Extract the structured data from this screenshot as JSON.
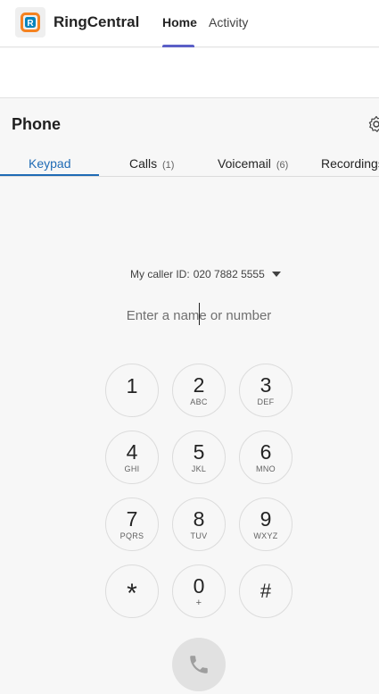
{
  "header": {
    "app_title": "RingCentral",
    "logo_letter": "R",
    "tabs": [
      {
        "label": "Home",
        "active": true
      },
      {
        "label": "Activity",
        "active": false
      }
    ],
    "accent_color": "#5b5fc7"
  },
  "phone": {
    "title": "Phone",
    "tabs": [
      {
        "label": "Keypad",
        "count": "",
        "active": true
      },
      {
        "label": "Calls",
        "count": "(1)",
        "active": false
      },
      {
        "label": "Voicemail",
        "count": "(6)",
        "active": false
      },
      {
        "label": "Recordings",
        "count": "",
        "active": false
      }
    ],
    "active_tab_color": "#1f6bb5"
  },
  "dialer": {
    "caller_id_label": "My caller ID:",
    "caller_id_number": "020 7882 5555",
    "input_placeholder": "Enter a name or number",
    "input_value": "",
    "keys": [
      {
        "digit": "1",
        "letters": ""
      },
      {
        "digit": "2",
        "letters": "ABC"
      },
      {
        "digit": "3",
        "letters": "DEF"
      },
      {
        "digit": "4",
        "letters": "GHI"
      },
      {
        "digit": "5",
        "letters": "JKL"
      },
      {
        "digit": "6",
        "letters": "MNO"
      },
      {
        "digit": "7",
        "letters": "PQRS"
      },
      {
        "digit": "8",
        "letters": "TUV"
      },
      {
        "digit": "9",
        "letters": "WXYZ"
      },
      {
        "digit": "*",
        "letters": ""
      },
      {
        "digit": "0",
        "letters": "+"
      },
      {
        "digit": "#",
        "letters": ""
      }
    ]
  }
}
